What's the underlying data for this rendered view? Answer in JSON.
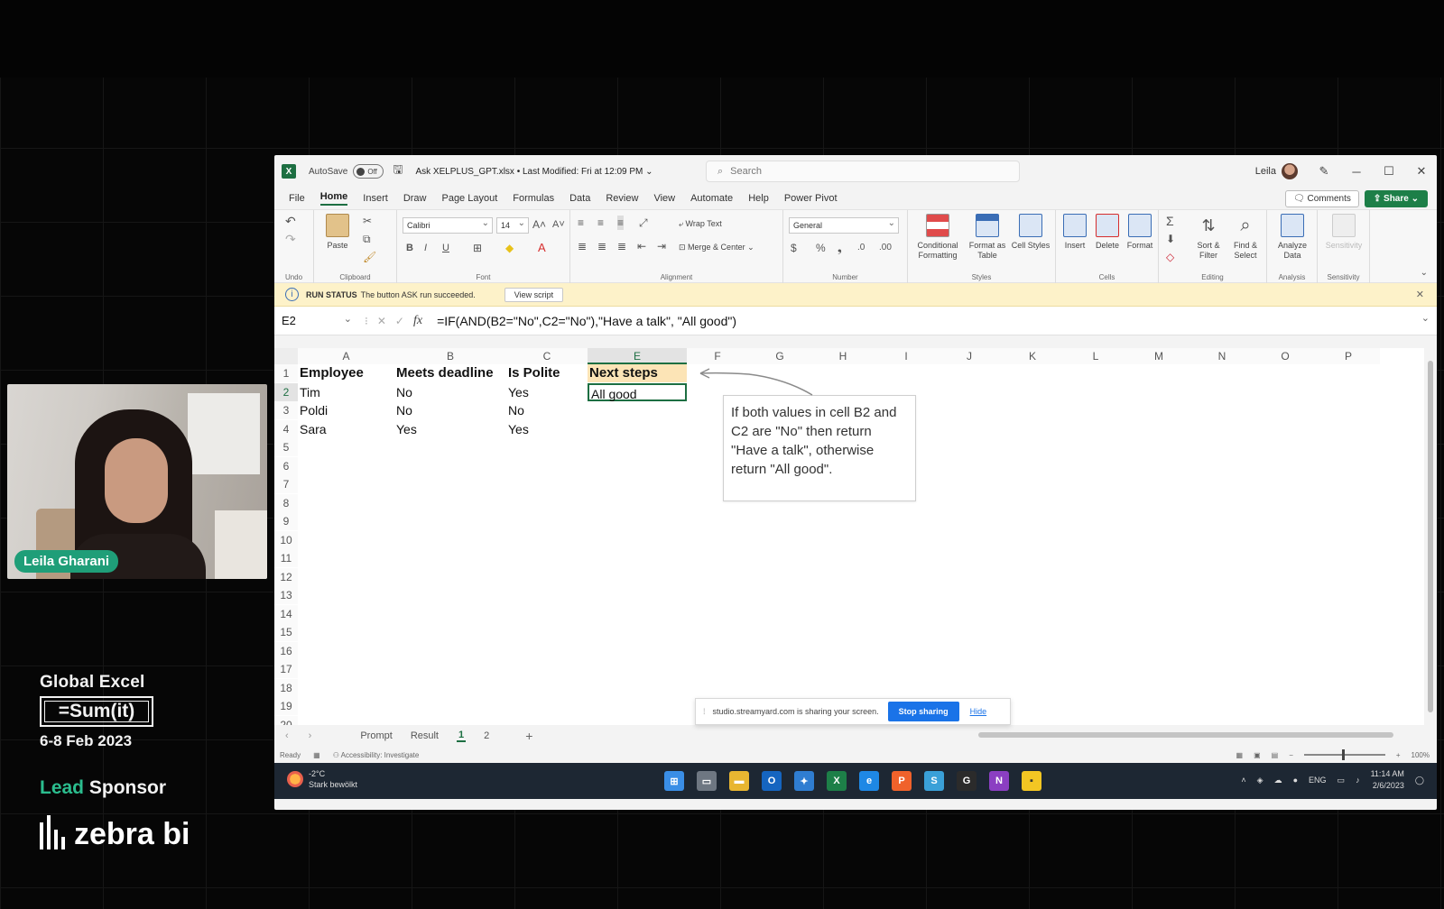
{
  "presenter": {
    "name": "Leila Gharani"
  },
  "event": {
    "title": "Global Excel",
    "logo_text": "=Sum(it)",
    "dates": "6-8 Feb 2023",
    "lead": "Lead",
    "sponsor": "Sponsor",
    "sponsor_name": "zebra bi"
  },
  "excel": {
    "autosave_label": "AutoSave",
    "autosave_state": "Off",
    "file_title": "Ask XELPLUS_GPT.xlsx • Last Modified: Fri at 12:09 PM ⌄",
    "search_placeholder": "Search",
    "user": "Leila",
    "menu": [
      "File",
      "Home",
      "Insert",
      "Draw",
      "Page Layout",
      "Formulas",
      "Data",
      "Review",
      "View",
      "Automate",
      "Help",
      "Power Pivot"
    ],
    "comments_label": "Comments",
    "share_label": "Share",
    "ribbon": {
      "undo_group": "Undo",
      "clipboard_group": "Clipboard",
      "paste": "Paste",
      "font_group": "Font",
      "font_name": "Calibri",
      "font_size": "14",
      "alignment_group": "Alignment",
      "wrap_text": "Wrap Text",
      "merge_center": "Merge & Center",
      "number_group": "Number",
      "number_format": "General",
      "styles_group": "Styles",
      "cond_formatting": "Conditional Formatting",
      "format_table": "Format as Table",
      "cell_styles": "Cell Styles",
      "cells_group": "Cells",
      "insert": "Insert",
      "delete": "Delete",
      "format": "Format",
      "editing_group": "Editing",
      "sort_filter": "Sort & Filter",
      "find_select": "Find & Select",
      "analysis_group": "Analysis",
      "analyze_data": "Analyze Data",
      "sensitivity_group": "Sensitivity",
      "sensitivity": "Sensitivity"
    },
    "message": {
      "status_label": "RUN STATUS",
      "text": "The button ASK run succeeded.",
      "button": "View script"
    },
    "name_box": "E2",
    "formula": "=IF(AND(B2=\"No\",C2=\"No\"),\"Have a talk\", \"All good\")",
    "columns": [
      "A",
      "B",
      "C",
      "E",
      "F",
      "G",
      "H",
      "I",
      "J",
      "K",
      "L",
      "M",
      "N",
      "O",
      "P"
    ],
    "rows": [
      "1",
      "2",
      "3",
      "4",
      "5",
      "6",
      "7",
      "8",
      "9",
      "10",
      "11",
      "12",
      "13",
      "14",
      "15",
      "16",
      "17",
      "18",
      "19",
      "20"
    ],
    "table": {
      "headers": [
        "Employee",
        "Meets deadline",
        "Is Polite",
        "Next steps"
      ],
      "data": [
        [
          "Tim",
          "No",
          "Yes",
          "All good"
        ],
        [
          "Poldi",
          "No",
          "No",
          ""
        ],
        [
          "Sara",
          "Yes",
          "Yes",
          ""
        ]
      ]
    },
    "comment": "If both values in cell B2 and C2 are \"No\" then return \"Have a talk\", otherwise return \"All good\".",
    "sheets": [
      "Prompt",
      "Result",
      "1",
      "2"
    ],
    "status": {
      "ready": "Ready",
      "accessibility": "Accessibility: Investigate",
      "zoom": "100%"
    },
    "share_popup": {
      "text": "studio.streamyard.com is sharing your screen.",
      "stop": "Stop sharing",
      "hide": "Hide"
    }
  },
  "taskbar": {
    "temp": "-2°C",
    "weather": "Stark bewölkt",
    "lang": "ENG",
    "time": "11:14 AM",
    "date": "2/6/2023"
  }
}
